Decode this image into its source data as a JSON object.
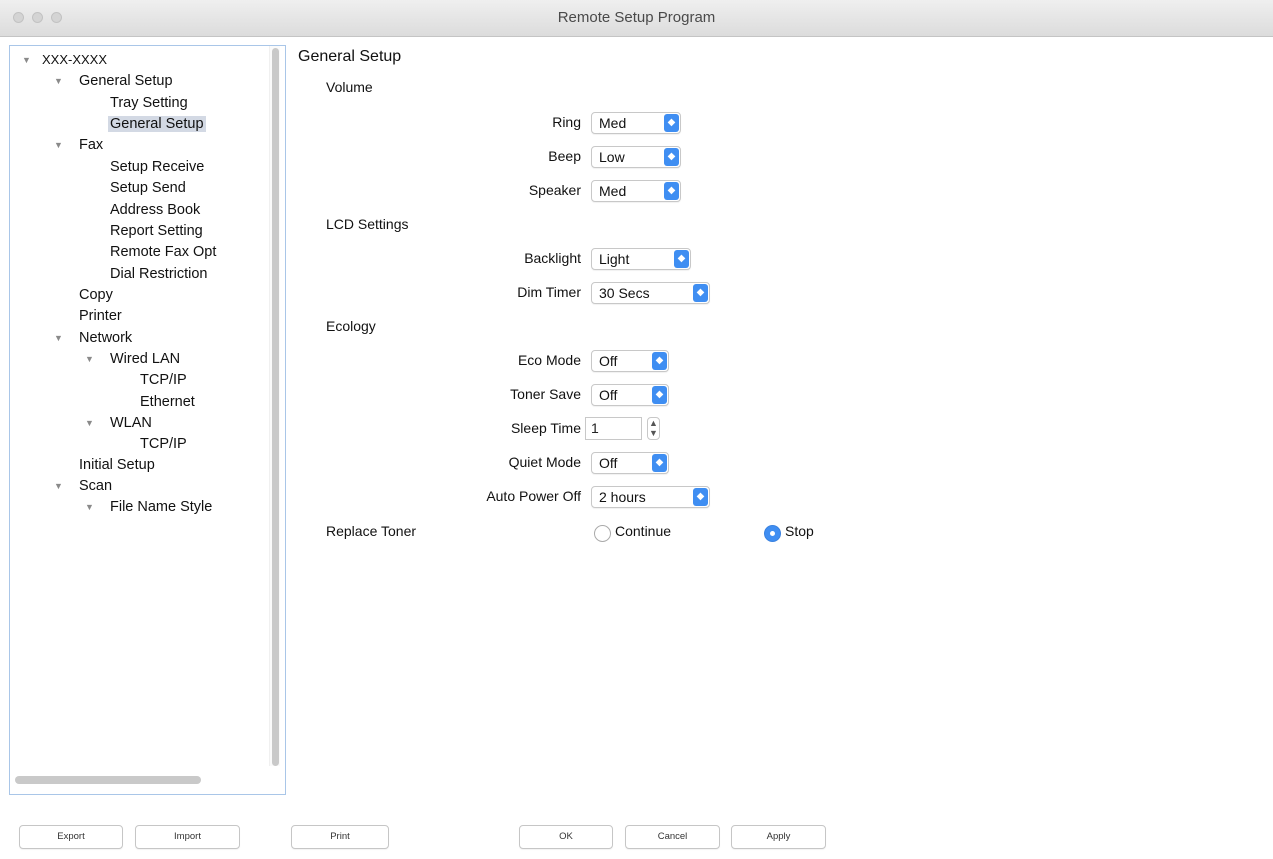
{
  "window": {
    "title": "Remote Setup Program"
  },
  "tree": {
    "items": [
      {
        "label": "XXX-XXXX",
        "expanded": true
      },
      {
        "label": "General Setup",
        "expanded": true
      },
      {
        "label": "Tray Setting"
      },
      {
        "label": "General Setup",
        "selected": true
      },
      {
        "label": "Fax",
        "expanded": true
      },
      {
        "label": "Setup Receive"
      },
      {
        "label": "Setup Send"
      },
      {
        "label": "Address Book"
      },
      {
        "label": "Report Setting"
      },
      {
        "label": "Remote Fax Opt"
      },
      {
        "label": "Dial Restriction"
      },
      {
        "label": "Copy"
      },
      {
        "label": "Printer"
      },
      {
        "label": "Network",
        "expanded": true
      },
      {
        "label": "Wired LAN",
        "expanded": true
      },
      {
        "label": "TCP/IP"
      },
      {
        "label": "Ethernet"
      },
      {
        "label": "WLAN",
        "expanded": true
      },
      {
        "label": "TCP/IP"
      },
      {
        "label": "Initial Setup"
      },
      {
        "label": "Scan",
        "expanded": true
      },
      {
        "label": "File Name Style",
        "expanded": true
      }
    ]
  },
  "panel": {
    "title": "General Setup",
    "volume": {
      "heading": "Volume",
      "ring": {
        "label": "Ring",
        "value": "Med"
      },
      "beep": {
        "label": "Beep",
        "value": "Low"
      },
      "speaker": {
        "label": "Speaker",
        "value": "Med"
      }
    },
    "lcd": {
      "heading": "LCD Settings",
      "backlight": {
        "label": "Backlight",
        "value": "Light"
      },
      "dim_timer": {
        "label": "Dim Timer",
        "value": "30 Secs"
      }
    },
    "ecology": {
      "heading": "Ecology",
      "eco_mode": {
        "label": "Eco Mode",
        "value": "Off"
      },
      "toner_save": {
        "label": "Toner Save",
        "value": "Off"
      },
      "sleep_time": {
        "label": "Sleep Time",
        "value": "1"
      },
      "quiet_mode": {
        "label": "Quiet Mode",
        "value": "Off"
      },
      "auto_power_off": {
        "label": "Auto Power Off",
        "value": "2 hours"
      }
    },
    "replace_toner": {
      "heading": "Replace Toner",
      "options": [
        "Continue",
        "Stop"
      ],
      "selected": "Stop"
    }
  },
  "buttons": {
    "export": "Export",
    "import": "Import",
    "print": "Print",
    "ok": "OK",
    "cancel": "Cancel",
    "apply": "Apply"
  },
  "colors": {
    "accent": "#3f8ef2",
    "selection": "#d3d9e4",
    "tree_border": "#a9c6e8"
  }
}
